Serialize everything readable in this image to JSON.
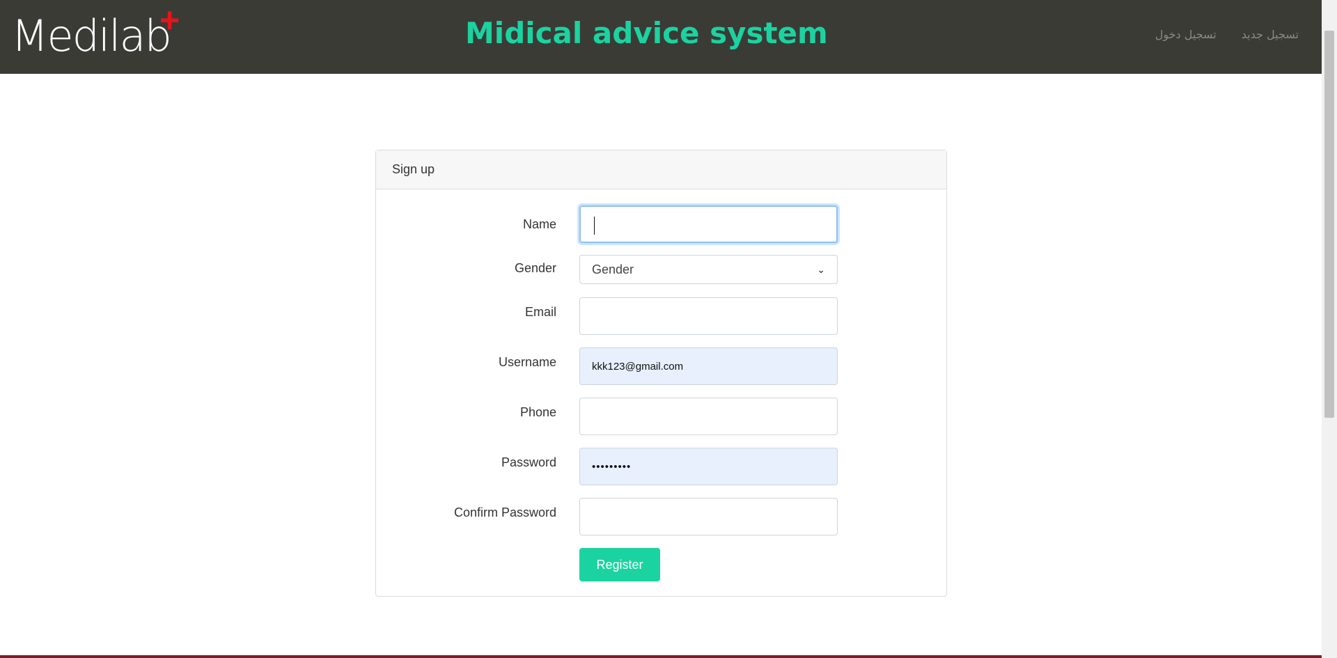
{
  "header": {
    "brand": "Medilab",
    "brand_plus": "+",
    "title": "Midical advice system",
    "nav": [
      "تسجيل جديد",
      "تسجيل دخول"
    ]
  },
  "form": {
    "heading": "Sign up",
    "fields": [
      {
        "label": "Name",
        "value": ""
      },
      {
        "label": "Gender",
        "value": "Gender"
      },
      {
        "label": "Email",
        "value": ""
      },
      {
        "label": "Username",
        "value": "kkk123@gmail.com"
      },
      {
        "label": "Phone",
        "value": ""
      },
      {
        "label": "Password",
        "value": "•••••••••"
      },
      {
        "label": "Confirm Password",
        "value": ""
      }
    ],
    "submit_label": "Register"
  },
  "colors": {
    "navbar": "#3b3b36",
    "accent": "#1bd3a0",
    "brand_plus": "#e8141a",
    "autofill": "#e8f0fe"
  }
}
